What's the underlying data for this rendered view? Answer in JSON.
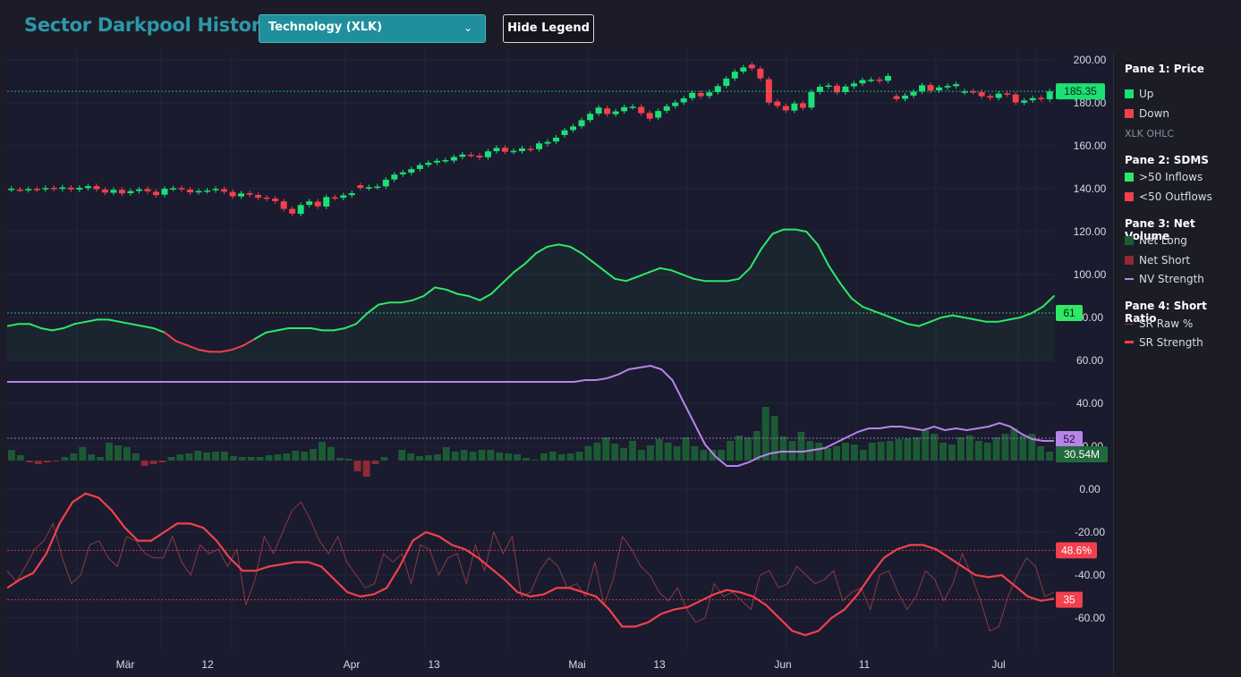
{
  "header": {
    "title": "Sector Darkpool History",
    "sector_select": "Technology (XLK)",
    "hide_legend": "Hide Legend"
  },
  "legend": {
    "pane1_title": "Pane 1: Price",
    "up": "Up",
    "down": "Down",
    "ohlc": "XLK OHLC",
    "pane2_title": "Pane 2: SDMS",
    "inflows": ">50 Inflows",
    "outflows": "<50 Outflows",
    "pane3_title": "Pane 3: Net Volume",
    "net_long": "Net Long",
    "net_short": "Net Short",
    "nv_strength": "NV Strength",
    "pane4_title": "Pane 4: Short Ratio",
    "sr_raw": "SR Raw %",
    "sr_strength": "SR Strength"
  },
  "colors": {
    "up": "#1be075",
    "down": "#f2404d",
    "inflow": "#2ee866",
    "outflow": "#f2404d",
    "net_long": "#1c5a35",
    "net_short": "#8d2a35",
    "nv_strength": "#b784e8",
    "sr_raw": "#8a3a42",
    "sr_strength": "#f2404d"
  },
  "chart_data": {
    "type": "line",
    "y_axis_ticks": [
      "200.00",
      "180.00",
      "160.00",
      "140.00",
      "120.00",
      "100.00",
      "80.00",
      "60.00",
      "40.00",
      "20.00",
      "0.00",
      "-20.00",
      "-40.00",
      "-60.00"
    ],
    "x_axis_ticks": [
      "Mär",
      "12",
      "Apr",
      "13",
      "Mai",
      "13",
      "Jun",
      "11",
      "Jul"
    ],
    "markers": {
      "price": "185.35",
      "sdms": "61",
      "nv_strength": "52",
      "net_volume": "30.54M",
      "sr_raw": "48.6%",
      "sr_strength": "35"
    },
    "price_candles": [
      [
        139.5,
        140.0
      ],
      [
        139.6,
        139.5
      ],
      [
        139.4,
        139.8
      ],
      [
        139.9,
        139.7
      ],
      [
        139.7,
        140.3
      ],
      [
        140.4,
        140.0
      ],
      [
        139.9,
        140.6
      ],
      [
        140.5,
        139.7
      ],
      [
        139.6,
        140.4
      ],
      [
        140.3,
        141.2
      ],
      [
        141.2,
        139.8
      ],
      [
        139.6,
        138.2
      ],
      [
        138.1,
        139.5
      ],
      [
        139.5,
        137.8
      ],
      [
        137.9,
        138.9
      ],
      [
        138.9,
        139.7
      ],
      [
        139.8,
        138.8
      ],
      [
        138.6,
        137.0
      ],
      [
        137.2,
        140.0
      ],
      [
        140.1,
        140.2
      ],
      [
        140.3,
        139.8
      ],
      [
        139.6,
        138.3
      ],
      [
        138.4,
        138.9
      ],
      [
        139.0,
        139.2
      ],
      [
        139.3,
        139.9
      ],
      [
        139.8,
        138.6
      ],
      [
        138.5,
        136.5
      ],
      [
        136.4,
        137.8
      ],
      [
        137.9,
        137.2
      ],
      [
        137.1,
        135.8
      ],
      [
        135.9,
        135.3
      ],
      [
        135.4,
        134.2
      ],
      [
        134.1,
        130.6
      ],
      [
        130.6,
        128.4
      ],
      [
        128.3,
        132.4
      ],
      [
        132.5,
        134.1
      ],
      [
        134.0,
        131.8
      ],
      [
        131.7,
        136.1
      ],
      [
        136.0,
        135.7
      ],
      [
        135.8,
        136.9
      ],
      [
        137.0,
        137.9
      ],
      [
        141.6,
        140.4
      ],
      [
        140.3,
        140.7
      ],
      [
        140.8,
        141.0
      ],
      [
        141.1,
        144.2
      ],
      [
        144.3,
        146.6
      ],
      [
        146.7,
        147.6
      ],
      [
        147.5,
        149.1
      ],
      [
        149.2,
        151.0
      ],
      [
        151.1,
        152.1
      ],
      [
        152.2,
        153.0
      ],
      [
        153.1,
        153.3
      ],
      [
        153.1,
        154.8
      ],
      [
        154.9,
        155.9
      ],
      [
        155.8,
        155.6
      ],
      [
        155.4,
        154.6
      ],
      [
        154.7,
        157.4
      ],
      [
        157.5,
        159.0
      ],
      [
        159.1,
        157.2
      ],
      [
        157.3,
        157.6
      ],
      [
        157.5,
        158.8
      ],
      [
        158.6,
        158.3
      ],
      [
        158.4,
        161.1
      ],
      [
        161.0,
        161.8
      ],
      [
        162.0,
        163.8
      ],
      [
        165.0,
        167.2
      ],
      [
        167.3,
        169.0
      ],
      [
        169.1,
        171.9
      ],
      [
        172.0,
        174.9
      ],
      [
        175.0,
        177.8
      ],
      [
        177.4,
        174.8
      ],
      [
        174.7,
        176.0
      ],
      [
        176.1,
        178.0
      ],
      [
        178.1,
        178.2
      ],
      [
        178.1,
        175.2
      ],
      [
        175.3,
        172.6
      ],
      [
        173.1,
        176.2
      ],
      [
        176.3,
        178.4
      ],
      [
        178.5,
        180.1
      ],
      [
        180.2,
        182.1
      ],
      [
        182.2,
        184.7
      ],
      [
        184.6,
        183.1
      ],
      [
        183.2,
        184.9
      ],
      [
        185.0,
        187.8
      ],
      [
        187.9,
        191.3
      ],
      [
        191.4,
        194.5
      ],
      [
        194.6,
        196.5
      ],
      [
        197.8,
        196.1
      ],
      [
        195.9,
        191.4
      ],
      [
        191.0,
        180.1
      ],
      [
        180.6,
        178.6
      ],
      [
        178.5,
        176.5
      ],
      [
        176.4,
        179.7
      ],
      [
        179.8,
        177.7
      ],
      [
        177.8,
        185.0
      ],
      [
        185.1,
        187.5
      ],
      [
        187.6,
        188.1
      ],
      [
        188.0,
        184.9
      ],
      [
        185.0,
        187.6
      ],
      [
        187.7,
        189.0
      ],
      [
        189.1,
        190.6
      ],
      [
        190.7,
        190.8
      ],
      [
        190.9,
        190.2
      ],
      [
        190.3,
        192.5
      ],
      [
        183.1,
        181.8
      ],
      [
        181.9,
        183.4
      ],
      [
        183.4,
        185.2
      ],
      [
        185.3,
        188.2
      ],
      [
        188.3,
        185.7
      ],
      [
        185.8,
        187.2
      ],
      [
        187.2,
        187.9
      ],
      [
        187.8,
        188.7
      ],
      [
        184.9,
        185.3
      ],
      [
        185.4,
        185.1
      ],
      [
        185.0,
        183.1
      ],
      [
        183.2,
        182.4
      ],
      [
        182.3,
        184.3
      ],
      [
        184.4,
        184.0
      ],
      [
        183.9,
        180.2
      ],
      [
        180.1,
        181.1
      ],
      [
        181.2,
        182.2
      ],
      [
        182.3,
        181.8
      ],
      [
        181.7,
        185.35
      ]
    ],
    "sdms": [
      76,
      77,
      77,
      75,
      74,
      75,
      77,
      78,
      79,
      79,
      78,
      77,
      76,
      75,
      73,
      69,
      67,
      65,
      64,
      64,
      65,
      67,
      70,
      73,
      74,
      75,
      75,
      75,
      74,
      74,
      75,
      77,
      82,
      86,
      87,
      87,
      88,
      90,
      94,
      93,
      91,
      90,
      88,
      91,
      96,
      101,
      105,
      110,
      113,
      114,
      113,
      110,
      106,
      102,
      98,
      97,
      99,
      101,
      103,
      102,
      100,
      98,
      97,
      97,
      97,
      98,
      103,
      112,
      119,
      121,
      121,
      120,
      114,
      104,
      96,
      89,
      85,
      83,
      81,
      79,
      77,
      76,
      78,
      80,
      81,
      80,
      79,
      78,
      78,
      79,
      80,
      82,
      85,
      90,
      61
    ],
    "net_volume": [
      12,
      6,
      -2,
      -4,
      -2,
      -1,
      4,
      8,
      15,
      7,
      4,
      20,
      17,
      15,
      8,
      -6,
      -4,
      -2,
      4,
      7,
      8,
      11,
      9,
      10,
      10,
      5,
      4,
      4,
      4,
      6,
      7,
      8,
      11,
      10,
      13,
      21,
      15,
      3,
      2,
      -12,
      -18,
      -4,
      4,
      0,
      12,
      8,
      5,
      6,
      7,
      15,
      10,
      12,
      10,
      12,
      12,
      9,
      8,
      7,
      3,
      1,
      8,
      10,
      7,
      8,
      10,
      16,
      20,
      26,
      19,
      14,
      22,
      12,
      17,
      24,
      20,
      16,
      26,
      16,
      12,
      12,
      12,
      22,
      28,
      26,
      33,
      60,
      50,
      27,
      22,
      32,
      22,
      20,
      14,
      16,
      20,
      18,
      12,
      20,
      21,
      22,
      24,
      25,
      26,
      34,
      30,
      20,
      18,
      26,
      28,
      22,
      20,
      26,
      30,
      36,
      28,
      30,
      16,
      10
    ],
    "nv_strength": [
      51,
      51,
      51,
      51,
      51,
      51,
      51,
      51,
      51,
      51,
      51,
      51,
      51,
      51,
      51,
      51,
      51,
      51,
      51,
      51,
      51,
      51,
      51,
      51,
      51,
      51,
      51,
      51,
      51,
      51,
      51,
      51,
      51,
      51,
      51,
      51,
      51,
      51,
      51,
      51,
      51,
      51,
      51,
      51,
      51,
      51,
      51,
      51,
      51,
      51,
      51,
      51,
      51,
      52,
      52,
      53,
      55,
      58,
      59,
      60,
      58,
      52,
      40,
      28,
      16,
      9,
      4,
      4,
      6,
      9,
      11,
      12,
      12,
      12,
      13,
      14,
      17,
      20,
      23,
      25,
      25,
      26,
      26,
      25,
      24,
      26,
      24,
      25,
      24,
      25,
      26,
      28,
      26,
      22,
      19,
      18,
      18,
      52
    ],
    "sr_raw": [
      -38,
      -43,
      -36,
      -28,
      -24,
      -16,
      -32,
      -44,
      -40,
      -26,
      -24,
      -32,
      -36,
      -22,
      -24,
      -30,
      -32,
      -32,
      -22,
      -34,
      -40,
      -26,
      -30,
      -28,
      -36,
      -28,
      -54,
      -42,
      -22,
      -30,
      -20,
      -10,
      -6,
      -14,
      -24,
      -30,
      -22,
      -34,
      -40,
      -46,
      -44,
      -30,
      -34,
      -30,
      -44,
      -26,
      -28,
      -40,
      -32,
      -30,
      -44,
      -26,
      -38,
      -20,
      -30,
      -22,
      -50,
      -48,
      -38,
      -32,
      -36,
      -46,
      -44,
      -50,
      -34,
      -54,
      -42,
      -22,
      -28,
      -36,
      -40,
      -48,
      -52,
      -46,
      -56,
      -62,
      -60,
      -44,
      -50,
      -48,
      -52,
      -56,
      -40,
      -38,
      -46,
      -44,
      -36,
      -40,
      -44,
      -42,
      -38,
      -52,
      -48,
      -46,
      -56,
      -40,
      -38,
      -48,
      -56,
      -50,
      -38,
      -42,
      -52,
      -44,
      -30,
      -40,
      -52,
      -66,
      -64,
      -50,
      -40,
      -32,
      -36,
      -50,
      -48
    ],
    "sr_strength": [
      -46,
      -42,
      -39,
      -30,
      -16,
      -6,
      -2,
      -4,
      -10,
      -18,
      -24,
      -24,
      -20,
      -16,
      -16,
      -18,
      -24,
      -32,
      -38,
      -38,
      -36,
      -35,
      -34,
      -34,
      -36,
      -42,
      -48,
      -50,
      -49,
      -46,
      -36,
      -24,
      -20,
      -22,
      -26,
      -28,
      -32,
      -37,
      -42,
      -48,
      -50,
      -49,
      -46,
      -46,
      -48,
      -50,
      -56,
      -64,
      -64,
      -62,
      -58,
      -56,
      -55,
      -52,
      -49,
      -47,
      -48,
      -50,
      -54,
      -60,
      -66,
      -68,
      -66,
      -60,
      -56,
      -49,
      -40,
      -32,
      -28,
      -26,
      -26,
      -28,
      -32,
      -36,
      -40,
      -41,
      -40,
      -45,
      -50,
      -52,
      -51,
      -35
    ]
  }
}
